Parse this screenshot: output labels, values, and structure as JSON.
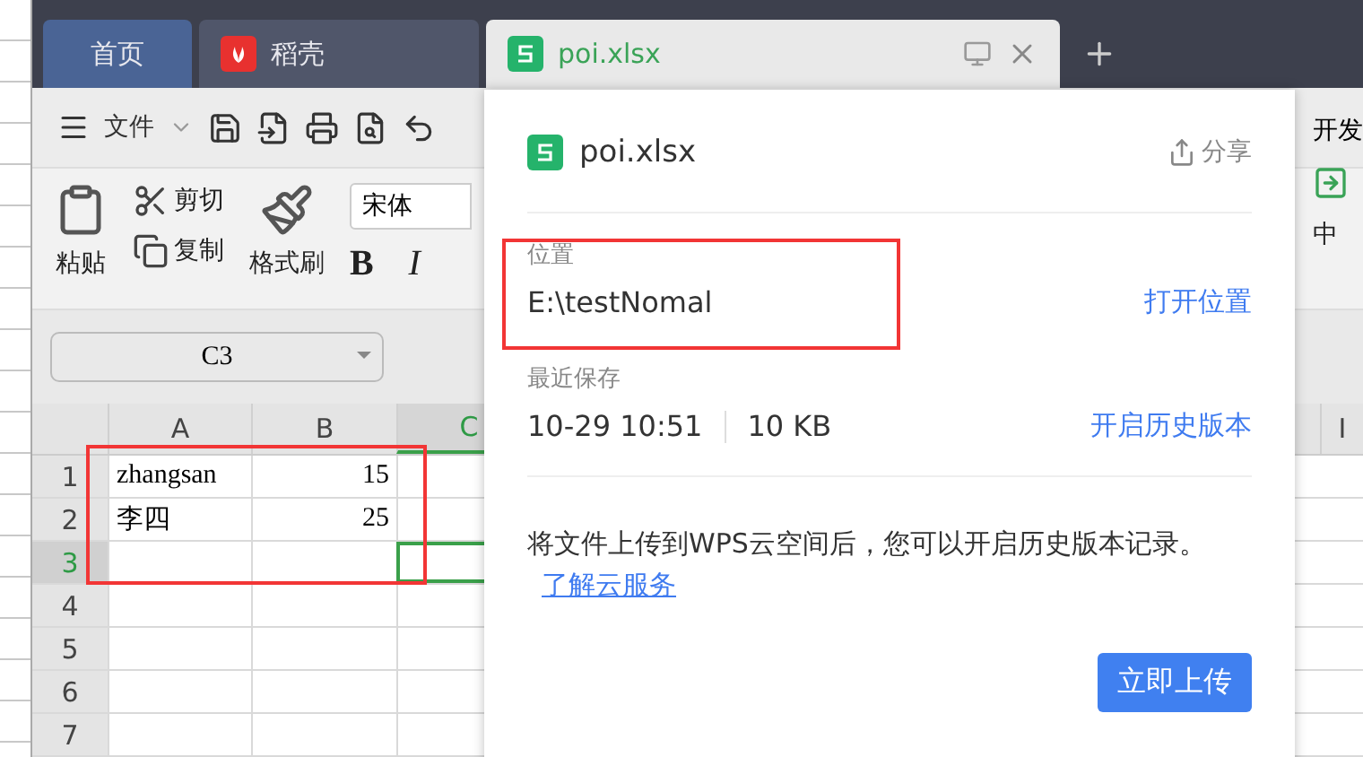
{
  "tabs": [
    {
      "label": "首页",
      "kind": "home",
      "selected": false
    },
    {
      "label": "稻壳",
      "kind": "docer",
      "selected": false
    },
    {
      "label": "poi.xlsx",
      "kind": "sheet",
      "selected": true
    }
  ],
  "toolbar": {
    "menu": "文件"
  },
  "ribbon": [
    {
      "kind": "paste",
      "label": "粘贴"
    },
    {
      "kind": "cut",
      "label": "剪切"
    },
    {
      "kind": "copy",
      "label": "复制"
    },
    {
      "kind": "painter",
      "label": "格式刷"
    }
  ],
  "font": {
    "value": "宋体",
    "bold": "B",
    "italic": "I"
  },
  "right_ribbon": {
    "tab": "开发",
    "merge": "中"
  },
  "name_box": "C3",
  "sheet": {
    "columns": [
      {
        "label": "A",
        "selected": false
      },
      {
        "label": "B",
        "selected": false
      },
      {
        "label": "C",
        "selected": true
      }
    ],
    "far_column": "I",
    "rows": [
      {
        "header": "1",
        "selected": false,
        "cells": [
          {
            "text": "zhangsan",
            "kind": "text"
          },
          {
            "text": "15",
            "kind": "number"
          }
        ]
      },
      {
        "header": "2",
        "selected": false,
        "cells": [
          {
            "text": "李四",
            "kind": "text"
          },
          {
            "text": "25",
            "kind": "number"
          }
        ]
      },
      {
        "header": "3",
        "selected": true,
        "cells": []
      },
      {
        "header": "4",
        "selected": false,
        "cells": []
      },
      {
        "header": "5",
        "selected": false,
        "cells": []
      },
      {
        "header": "6",
        "selected": false,
        "cells": []
      },
      {
        "header": "7",
        "selected": false,
        "cells": []
      }
    ]
  },
  "popup": {
    "title": "poi.xlsx",
    "share": "分享",
    "location_label": "位置",
    "location": "E:\\testNomal",
    "open_location": "打开位置",
    "saved_label": "最近保存",
    "saved_time": "10-29 10:51",
    "size": "10 KB",
    "history": "开启历史版本",
    "message": "将文件上传到WPS云空间后，您可以开启历史版本记录。",
    "link": "了解云服务",
    "upload": "立即上传"
  }
}
